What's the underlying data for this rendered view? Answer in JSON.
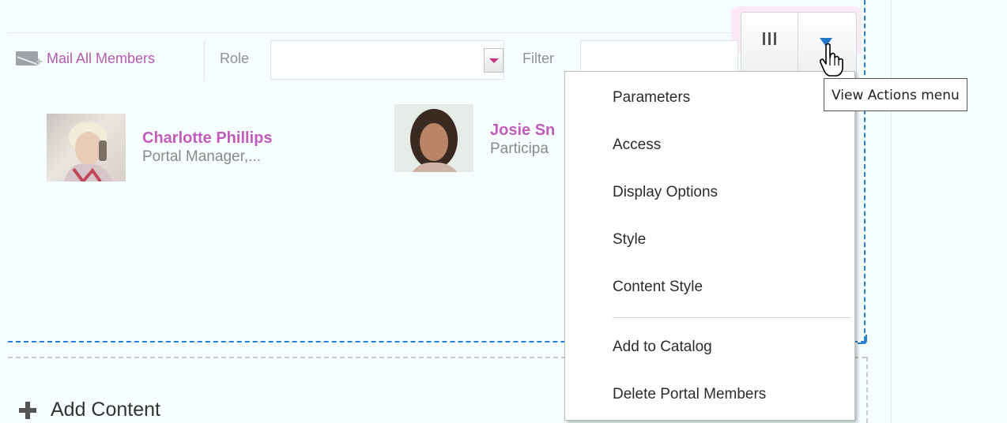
{
  "toolbar": {
    "mail_label": "Mail All Members",
    "role_label": "Role",
    "role_value": "",
    "filter_label": "Filter",
    "filter_value": ""
  },
  "members": [
    {
      "name": "Charlotte Phillips",
      "role": "Portal Manager,..."
    },
    {
      "name": "Josie Sn",
      "role": "Participa"
    }
  ],
  "actions_menu": {
    "tooltip": "View Actions menu",
    "items": [
      "Parameters",
      "Access",
      "Display Options",
      "Style",
      "Content Style",
      "Add to Catalog",
      "Delete Portal Members"
    ]
  },
  "add_content_label": "Add Content",
  "colors": {
    "link": "#b45bb0",
    "member_name": "#c25cbb",
    "selection_border": "#2a7fd0",
    "dropdown_arrow": "#2474c8"
  }
}
